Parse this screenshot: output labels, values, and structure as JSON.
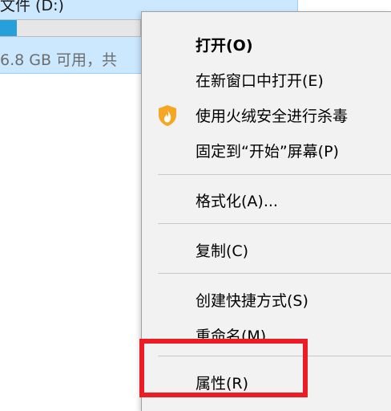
{
  "explorer": {
    "drive_name": "文件 (D:)",
    "drive_free": "6.8 GB 可用，共",
    "drive_usage_fraction": 0.12,
    "accent_color": "#26a0da"
  },
  "menu": {
    "open": "打开(O)",
    "open_new_window": "在新窗口中打开(E)",
    "scan_with_huorong": "使用火绒安全进行杀毒",
    "pin_to_start": "固定到“开始”屏幕(P)",
    "format": "格式化(A)...",
    "copy": "复制(C)",
    "create_shortcut": "创建快捷方式(S)",
    "rename": "重命名(M)",
    "properties": "属性(R)"
  },
  "annotation": {
    "highlight_color": "#ec1c24",
    "icon_huorong": "shield-flame-icon"
  }
}
